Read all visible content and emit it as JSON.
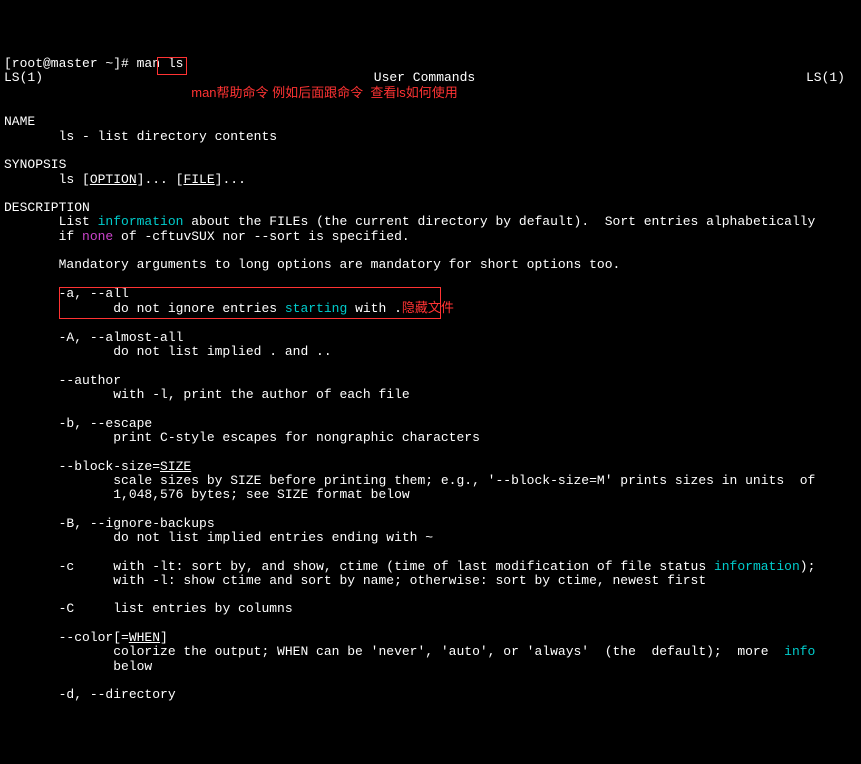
{
  "prompt": "[root@master ~]# man ls",
  "header": {
    "left": "LS(1)",
    "center": "User Commands",
    "right": "LS(1)"
  },
  "anno1": "man帮助命令 例如后面跟命令  查看ls如何使用",
  "sections": {
    "name": {
      "hdr": "NAME",
      "line": "ls - list directory contents"
    },
    "synopsis": {
      "hdr": "SYNOPSIS",
      "cmd": "ls",
      "opt": "OPTION",
      "file": "FILE"
    },
    "desc": {
      "hdr": "DESCRIPTION",
      "l1a": "List ",
      "info": "information",
      "l1b": " about the FILEs (the current directory by default).  Sort entries alphabetically",
      "l2a": "if ",
      "none": "none",
      "l2b": " of -cftuvSUX nor --sort is specified.",
      "l3": "Mandatory arguments to long options are mandatory for short options too.",
      "a": {
        "opt": "-a, --all",
        "d1": "do not ignore entries ",
        "starting": "starting",
        "d2": " with .",
        "ann": "隐藏文件"
      },
      "A": {
        "opt": "-A, --almost-all",
        "d": "do not list implied . and .."
      },
      "author": {
        "opt": "--author",
        "d": "with -l, print the author of each file"
      },
      "b": {
        "opt": "-b, --escape",
        "d": "print C-style escapes for nongraphic characters"
      },
      "blocksize": {
        "opt": "--block-size=",
        "arg": "SIZE",
        "d1": "scale sizes by SIZE before printing them; e.g., '--block-size=M' prints sizes in units  of",
        "d2": "1,048,576 bytes; see SIZE format below"
      },
      "B": {
        "opt": "-B, --ignore-backups",
        "d": "do not list implied entries ending with ~"
      },
      "c": {
        "opt": "-c",
        "d1": "with -lt: sort by, and show, ctime (time of last modification of file status ",
        "info": "information",
        "d1b": ");",
        "d2": "with -l: show ctime and sort by name; otherwise: sort by ctime, newest first"
      },
      "C": {
        "opt": "-C",
        "d": "list entries by columns"
      },
      "color": {
        "opt": "--color",
        "arg": "WHEN",
        "d1": "colorize the output; WHEN can be 'never', 'auto', or 'always'  (the  default);  more  ",
        "info": "info",
        "d2": "below"
      },
      "d": {
        "opt": "-d, --directory"
      }
    }
  }
}
